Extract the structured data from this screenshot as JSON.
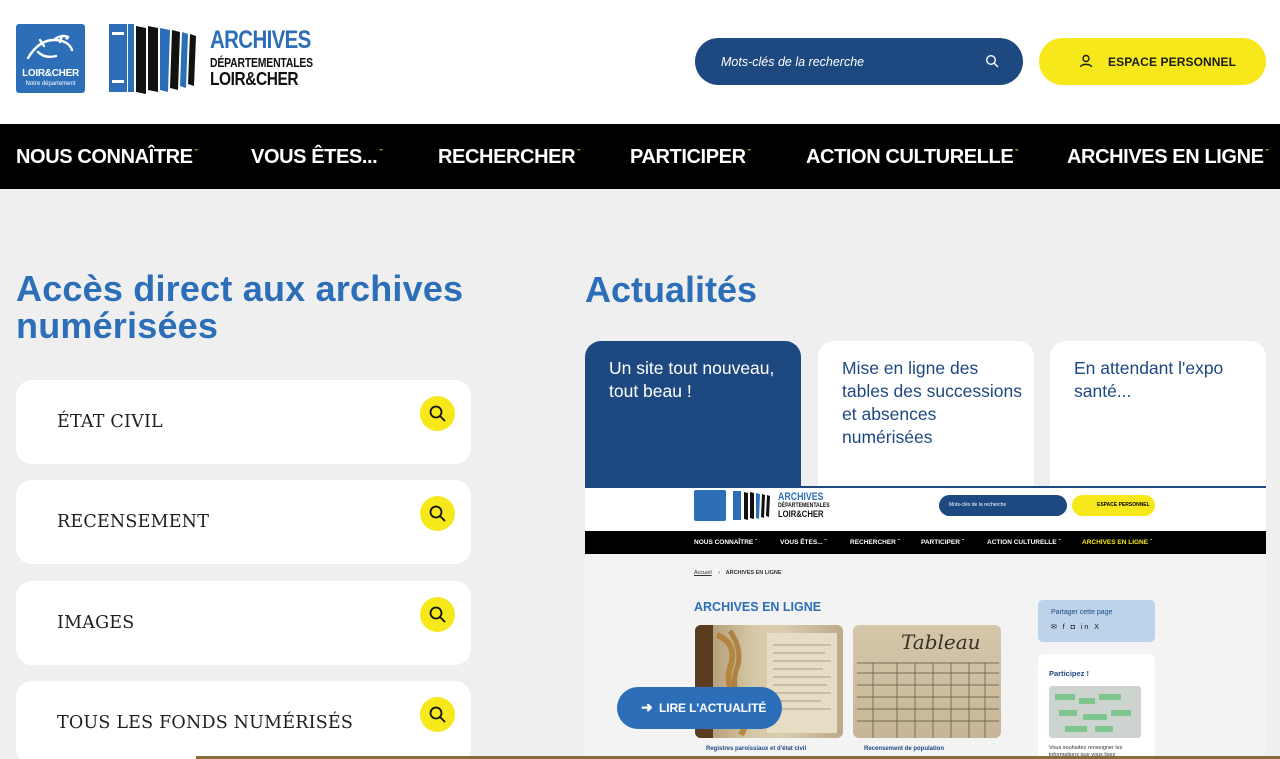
{
  "header": {
    "dept_logo": {
      "line1": "LOIR&CHER",
      "line2": "Notre département"
    },
    "archives_logo": {
      "line1": "ARCHIVES",
      "line2": "DÉPARTEMENTALES",
      "line3": "LOIR&CHER"
    },
    "search": {
      "placeholder": "Mots-clés de la recherche",
      "icon": "search-icon"
    },
    "espace_button": {
      "label": "ESPACE PERSONNEL",
      "icon": "user-icon"
    }
  },
  "nav": {
    "items": [
      {
        "label": "NOUS CONNAÎTRE"
      },
      {
        "label": "VOUS ÊTES..."
      },
      {
        "label": "RECHERCHER"
      },
      {
        "label": "PARTICIPER"
      },
      {
        "label": "ACTION CULTURELLE"
      },
      {
        "label": "ARCHIVES EN LIGNE"
      }
    ],
    "chevron": "ˇ"
  },
  "left": {
    "title": "Accès direct aux archives numérisées",
    "cards": [
      {
        "label": "ÉTAT CIVIL"
      },
      {
        "label": "RECENSEMENT"
      },
      {
        "label": "IMAGES"
      },
      {
        "label": "TOUS LES FONDS NUMÉRISÉS"
      }
    ]
  },
  "news": {
    "title": "Actualités",
    "cards": [
      {
        "label": "Un site tout nouveau, tout beau !"
      },
      {
        "label": "Mise en ligne des tables des successions et absences numérisées"
      },
      {
        "label": "En attendant l'expo santé..."
      }
    ],
    "read_button": {
      "label": "LIRE L'ACTUALITÉ",
      "icon": "arrow-right-icon"
    }
  },
  "preview": {
    "logo_line1": "ARCHIVES",
    "logo_line2": "DÉPARTEMENTALES",
    "logo_line3": "LOIR&CHER",
    "search_placeholder": "Mots-clés de la recherche",
    "espace_label": "ESPACE PERSONNEL",
    "nav": [
      {
        "label": "NOUS CONNAÎTRE ˇ"
      },
      {
        "label": "VOUS ÊTES... ˇ"
      },
      {
        "label": "RECHERCHER ˇ"
      },
      {
        "label": "PARTICIPER ˇ"
      },
      {
        "label": "ACTION CULTURELLE ˇ"
      },
      {
        "label": "ARCHIVES EN LIGNE ˇ"
      }
    ],
    "breadcrumb_home": "Accueil",
    "breadcrumb_sep": "›",
    "breadcrumb_current": "ARCHIVES EN LIGNE",
    "title": "ARCHIVES EN LIGNE",
    "doc_captions": [
      "Registres paroissiaux et d'état civil",
      "Recensement de population"
    ],
    "share_title": "Partager cette page",
    "share_icons": "✉ f ◘ in X",
    "participez_title": "Participez !",
    "participez_text": "Vous souhaitez renseigner les informations que vous lisez"
  },
  "colors": {
    "brand_blue": "#2c6fb8",
    "dark_blue": "#1d4880",
    "yellow": "#f7e81c",
    "nav_bg": "#000000",
    "page_bg": "#efefef"
  }
}
